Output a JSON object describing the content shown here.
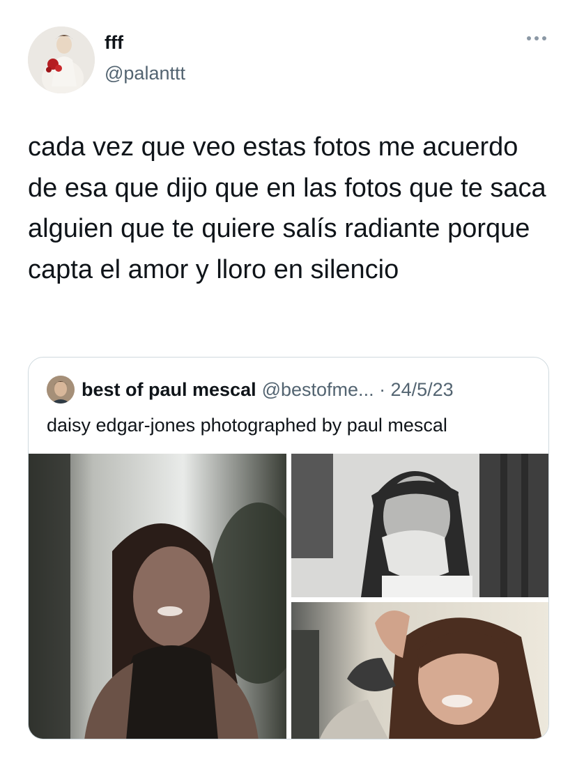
{
  "tweet": {
    "display_name": "fff",
    "handle": "@palanttt",
    "text": "cada vez que veo estas fotos me acuerdo de esa que dijo que en las fotos que te saca alguien que te quiere salís radiante porque capta el amor y lloro en silencio"
  },
  "quoted": {
    "name": "best of paul mescal",
    "handle_date": "@bestofme... · 24/5/23",
    "text": "daisy edgar-jones photographed by paul mescal",
    "photos": [
      "photo-1",
      "photo-2",
      "photo-3"
    ]
  },
  "icons": {
    "more": "more-horizontal-icon"
  }
}
